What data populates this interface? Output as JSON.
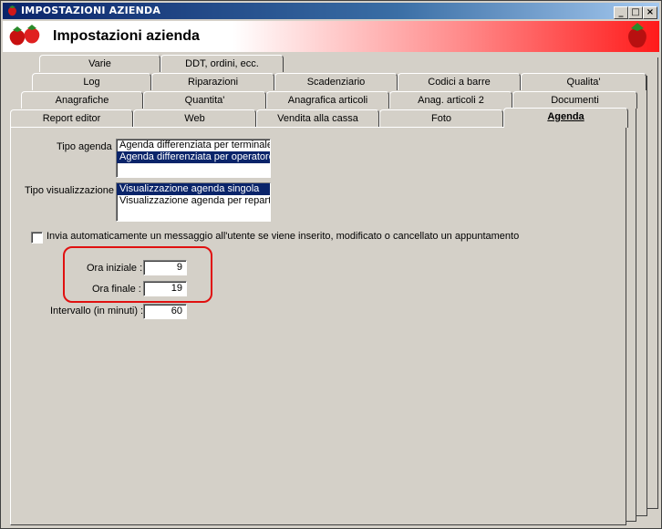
{
  "window": {
    "title": "IMPOSTAZIONI AZIENDA",
    "header_title": "Impostazioni azienda",
    "controls": [
      "_",
      "□",
      "×"
    ]
  },
  "tabs": {
    "row1": [
      "Varie",
      "DDT, ordini, ecc."
    ],
    "row2": [
      "Log",
      "Riparazioni",
      "Scadenziario",
      "Codici a barre",
      "Qualita'"
    ],
    "row3": [
      "Anagrafiche",
      "Quantita'",
      "Anagrafica articoli",
      "Anag. articoli 2",
      "Documenti"
    ],
    "row4": [
      "Report editor",
      "Web",
      "Vendita alla cassa",
      "Foto",
      "Agenda"
    ],
    "active": "Agenda"
  },
  "form": {
    "tipo_agenda_label": "Tipo agenda",
    "tipo_agenda_options": [
      "Agenda differenziata per terminale",
      "Agenda differenziata per operatore"
    ],
    "tipo_agenda_selected": 1,
    "tipo_vis_label": "Tipo visualizzazione",
    "tipo_vis_options": [
      "Visualizzazione agenda singola",
      "Visualizzazione agenda per reparto"
    ],
    "tipo_vis_selected": 0,
    "notify_label": "Invia automaticamente un messaggio all'utente se viene inserito, modificato o cancellato un appuntamento",
    "notify_checked": false,
    "ora_iniziale_label": "Ora iniziale :",
    "ora_iniziale_value": "9",
    "ora_finale_label": "Ora finale :",
    "ora_finale_value": "19",
    "intervallo_label": "Intervallo (in minuti) :",
    "intervallo_value": "60"
  },
  "colors": {
    "highlight": "#e01010",
    "selection": "#0a246a",
    "title_bar": "#0a246a"
  },
  "icons": {
    "title": "strawberry-icon",
    "header_left": "strawberries-icon",
    "header_right": "strawberry-icon"
  }
}
